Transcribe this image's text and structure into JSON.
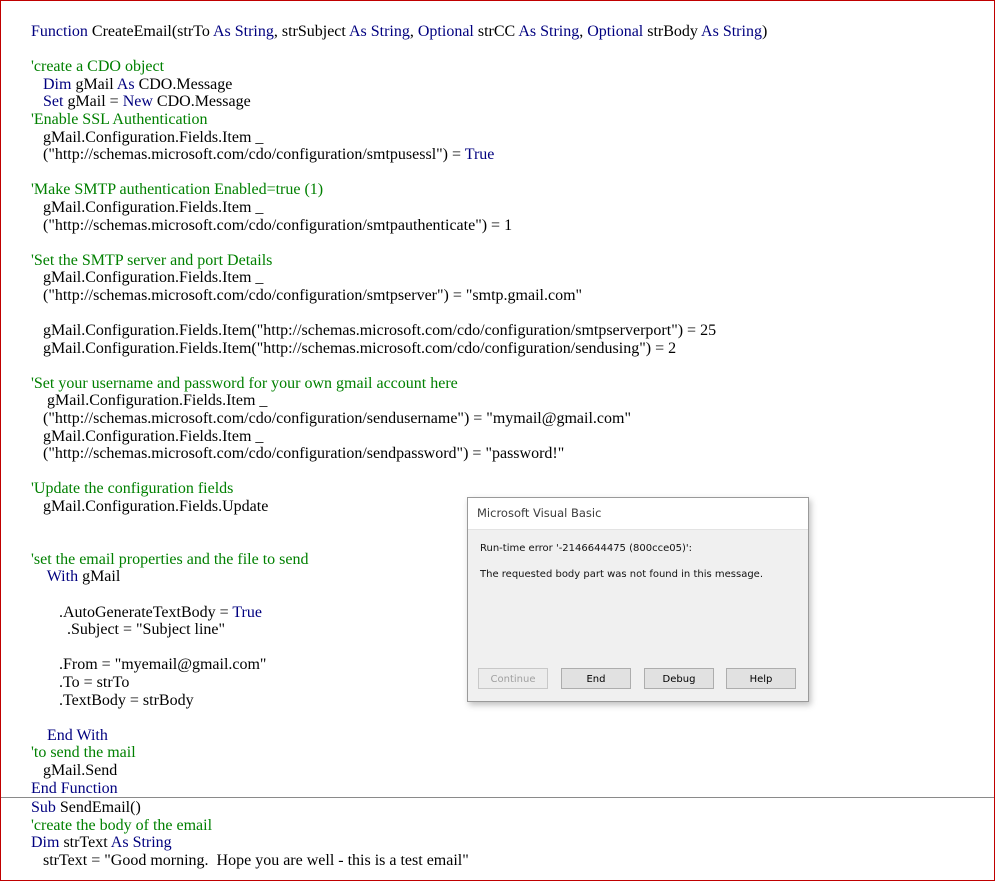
{
  "code_lines": [
    [
      {
        "t": "Function ",
        "c": "kw"
      },
      {
        "t": "CreateEmail(strTo "
      },
      {
        "t": "As String",
        "c": "kw"
      },
      {
        "t": ", strSubject "
      },
      {
        "t": "As String",
        "c": "kw"
      },
      {
        "t": ", "
      },
      {
        "t": "Optional",
        "c": "kw"
      },
      {
        "t": " strCC "
      },
      {
        "t": "As String",
        "c": "kw"
      },
      {
        "t": ", "
      },
      {
        "t": "Optional",
        "c": "kw"
      },
      {
        "t": " strBody "
      },
      {
        "t": "As String",
        "c": "kw"
      },
      {
        "t": ")"
      }
    ],
    [],
    [
      {
        "t": "'create a CDO object",
        "c": "cm"
      }
    ],
    [
      {
        "t": "   "
      },
      {
        "t": "Dim",
        "c": "kw"
      },
      {
        "t": " gMail "
      },
      {
        "t": "As",
        "c": "kw"
      },
      {
        "t": " CDO.Message"
      }
    ],
    [
      {
        "t": "   "
      },
      {
        "t": "Set",
        "c": "kw"
      },
      {
        "t": " gMail = "
      },
      {
        "t": "New",
        "c": "kw"
      },
      {
        "t": " CDO.Message"
      }
    ],
    [
      {
        "t": "'Enable SSL Authentication",
        "c": "cm"
      }
    ],
    [
      {
        "t": "   gMail.Configuration.Fields.Item _"
      }
    ],
    [
      {
        "t": "   (\"http://schemas.microsoft.com/cdo/configuration/smtpusessl\") = "
      },
      {
        "t": "True",
        "c": "kw"
      }
    ],
    [],
    [
      {
        "t": "'Make SMTP authentication Enabled=true (1)",
        "c": "cm"
      }
    ],
    [
      {
        "t": "   gMail.Configuration.Fields.Item _"
      }
    ],
    [
      {
        "t": "   (\"http://schemas.microsoft.com/cdo/configuration/smtpauthenticate\") = 1"
      }
    ],
    [],
    [
      {
        "t": "'Set the SMTP server and port Details",
        "c": "cm"
      }
    ],
    [
      {
        "t": "   gMail.Configuration.Fields.Item _"
      }
    ],
    [
      {
        "t": "   (\"http://schemas.microsoft.com/cdo/configuration/smtpserver\") = \"smtp.gmail.com\""
      }
    ],
    [],
    [
      {
        "t": "   gMail.Configuration.Fields.Item(\"http://schemas.microsoft.com/cdo/configuration/smtpserverport\") = 25"
      }
    ],
    [
      {
        "t": "   gMail.Configuration.Fields.Item(\"http://schemas.microsoft.com/cdo/configuration/sendusing\") = 2"
      }
    ],
    [],
    [
      {
        "t": "'Set your username and password for your own gmail account here",
        "c": "cm"
      }
    ],
    [
      {
        "t": "    gMail.Configuration.Fields.Item _"
      }
    ],
    [
      {
        "t": "   (\"http://schemas.microsoft.com/cdo/configuration/sendusername\") = \"mymail@gmail.com\""
      }
    ],
    [
      {
        "t": "   gMail.Configuration.Fields.Item _"
      }
    ],
    [
      {
        "t": "   (\"http://schemas.microsoft.com/cdo/configuration/sendpassword\") = \"password!\""
      }
    ],
    [],
    [
      {
        "t": "'Update the configuration fields",
        "c": "cm"
      }
    ],
    [
      {
        "t": "   gMail.Configuration.Fields.Update"
      }
    ],
    [],
    [],
    [
      {
        "t": "'set the email properties and the file to send",
        "c": "cm"
      }
    ],
    [
      {
        "t": "    "
      },
      {
        "t": "With",
        "c": "kw"
      },
      {
        "t": " gMail"
      }
    ],
    [],
    [
      {
        "t": "       .AutoGenerateTextBody = "
      },
      {
        "t": "True",
        "c": "kw"
      }
    ],
    [
      {
        "t": "         .Subject = \"Subject line\""
      }
    ],
    [],
    [
      {
        "t": "       .From = \"myemail@gmail.com\""
      }
    ],
    [
      {
        "t": "       .To = strTo"
      }
    ],
    [
      {
        "t": "       .TextBody = strBody"
      }
    ],
    [],
    [
      {
        "t": "    "
      },
      {
        "t": "End With",
        "c": "kw"
      }
    ],
    [
      {
        "t": "'to send the mail",
        "c": "cm"
      }
    ],
    [
      {
        "t": "   gMail.Send"
      }
    ],
    [
      {
        "t": "End Function",
        "c": "kw"
      }
    ]
  ],
  "code_lines_2": [
    [
      {
        "t": "Sub ",
        "c": "kw"
      },
      {
        "t": "SendEmail()"
      }
    ],
    [
      {
        "t": "'create the body of the email",
        "c": "cm"
      }
    ],
    [
      {
        "t": "Dim",
        "c": "kw"
      },
      {
        "t": " strText "
      },
      {
        "t": "As String",
        "c": "kw"
      }
    ],
    [
      {
        "t": "   strText = \"Good morning.  Hope you are well - this is a test email\""
      }
    ]
  ],
  "dialog": {
    "title": "Microsoft Visual Basic",
    "error_line": "Run-time error '-2146644475 (800cce05)':",
    "message": "The requested body part was not found in this message.",
    "buttons": {
      "continue": "Continue",
      "end": "End",
      "debug": "Debug",
      "help": "Help"
    }
  },
  "colors": {
    "keyword": "#00007f",
    "comment": "#008000",
    "frame_border": "#c00000"
  }
}
